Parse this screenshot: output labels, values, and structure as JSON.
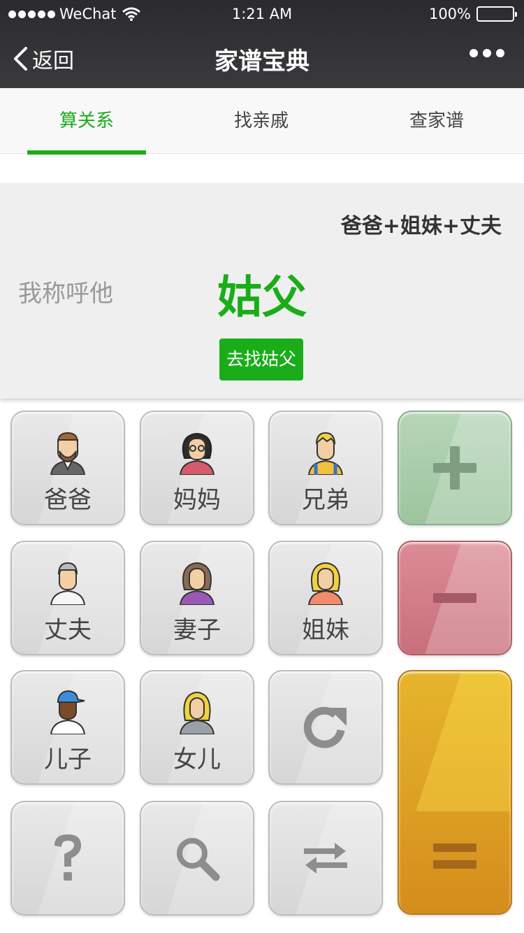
{
  "status_bar": {
    "carrier": "WeChat",
    "time": "1:21 AM",
    "battery": "100%"
  },
  "nav": {
    "back_label": "返回",
    "title": "家谱宝典"
  },
  "tabs": [
    {
      "label": "算关系",
      "active": true
    },
    {
      "label": "找亲戚",
      "active": false
    },
    {
      "label": "查家谱",
      "active": false
    }
  ],
  "result": {
    "formula": "爸爸+姐妹+丈夫",
    "call_label": "我称呼他",
    "answer": "姑父",
    "find_button": "去找姑父"
  },
  "keys": {
    "father": "爸爸",
    "mother": "妈妈",
    "brother": "兄弟",
    "husband": "丈夫",
    "wife": "妻子",
    "sister": "姐妹",
    "son": "儿子",
    "daughter": "女儿"
  },
  "colors": {
    "accent": "#1aad19",
    "plus_key": "#a7cba9",
    "minus_key": "#cf7a84",
    "equal_key": "#d8921f"
  },
  "icons": [
    "back-chevron-icon",
    "more-dots-icon",
    "wifi-icon",
    "battery-icon",
    "plus-icon",
    "minus-icon",
    "equal-icon",
    "redo-icon",
    "question-icon",
    "search-icon",
    "swap-icon"
  ]
}
